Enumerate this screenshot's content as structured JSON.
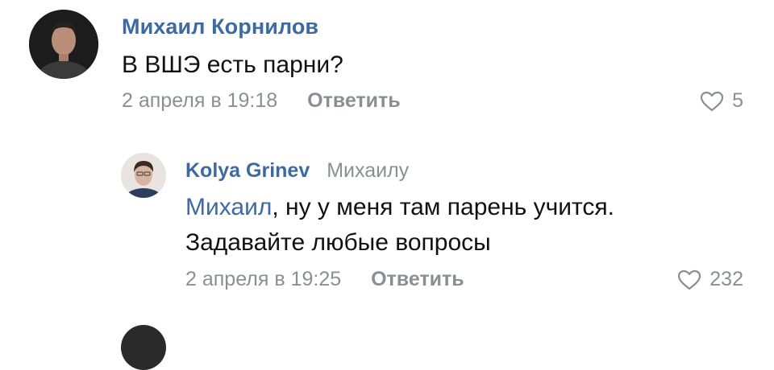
{
  "comments": [
    {
      "author": "Михаил Корнилов",
      "text": "В ВШЭ есть парни?",
      "date": "2 апреля в 19:18",
      "reply_label": "Ответить",
      "likes": "5",
      "avatar_icon": "user-avatar-icon"
    }
  ],
  "reply": {
    "author": "Kolya Grinev",
    "reply_to": "Михаилу",
    "mention": "Михаил",
    "text_after_mention": ", ну у меня там парень учится.",
    "text_line_2": "Задавайте любые вопросы",
    "date": "2 апреля в 19:25",
    "reply_label": "Ответить",
    "likes": "232",
    "avatar_icon": "user-avatar-icon"
  },
  "colors": {
    "author_link": "#3d6aa0",
    "meta_gray": "#8b8f95",
    "text": "#111111",
    "background": "#ffffff"
  },
  "icons": {
    "like": "heart-outline-icon"
  }
}
